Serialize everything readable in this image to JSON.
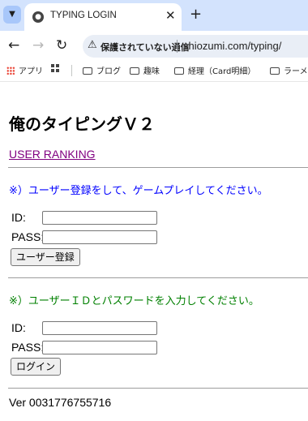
{
  "browser": {
    "tab_title": "TYPING LOGIN",
    "tab_close_glyph": "✕",
    "new_tab_glyph": "+",
    "security_warning": "保護されていない通信",
    "url": "shiozumi.com/typing/",
    "bookmarks": [
      {
        "label": "アプリ",
        "icon": "apps-icon"
      },
      {
        "label": "",
        "icon": "grid-icon"
      },
      {
        "label": "ブログ",
        "icon": "folder-icon"
      },
      {
        "label": "趣味",
        "icon": "folder-icon"
      },
      {
        "label": "経理（Card明細）",
        "icon": "folder-icon"
      },
      {
        "label": "ラーメン",
        "icon": "folder-icon"
      }
    ]
  },
  "page": {
    "title": "俺のタイピングＶ２",
    "ranking_link": "USER RANKING",
    "register": {
      "instruction": "※）ユーザー登録をして、ゲームプレイしてください。",
      "id_label": "ID:",
      "id_value": "",
      "pass_label": "PASS:",
      "pass_value": "",
      "button": "ユーザー登録"
    },
    "login": {
      "instruction": "※）ユーザーＩＤとパスワードを入力してください。",
      "id_label": "ID:",
      "id_value": "",
      "pass_label": "PASS:",
      "pass_value": "",
      "button": "ログイン"
    },
    "version": "Ver 0031776755716"
  },
  "colors": {
    "tabstrip": "#d3e3fd",
    "link_visited": "#800080",
    "instruction_register": "#0000ff",
    "instruction_login": "#008000"
  }
}
